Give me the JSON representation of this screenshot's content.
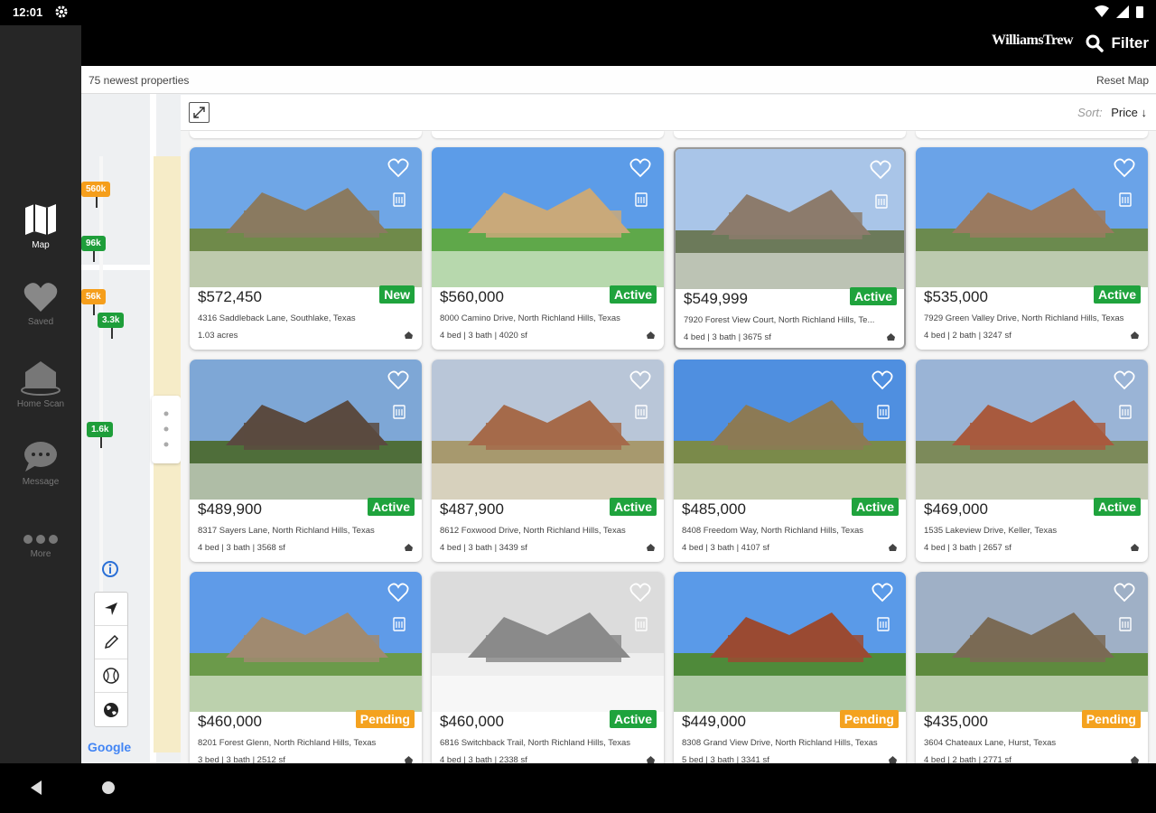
{
  "status_bar": {
    "time": "12:01"
  },
  "sidebar": {
    "items": [
      {
        "label": "Map",
        "icon": "map-icon",
        "active": true
      },
      {
        "label": "Saved",
        "icon": "heart-icon",
        "active": false
      },
      {
        "label": "Home Scan",
        "icon": "home-scan-icon",
        "active": false
      },
      {
        "label": "Message",
        "icon": "message-icon",
        "active": false
      },
      {
        "label": "More",
        "icon": "more-icon",
        "active": false
      }
    ]
  },
  "header": {
    "logo": "WilliamsTrew",
    "filter_label": "Filter"
  },
  "map": {
    "count_text": "75 newest properties",
    "reset_label": "Reset Map",
    "google": "Google",
    "pins": [
      {
        "label": "560k",
        "color": "orange"
      },
      {
        "label": "96k",
        "color": "green"
      },
      {
        "label": "56k",
        "color": "orange"
      },
      {
        "label": "3.3k",
        "color": "green"
      },
      {
        "label": "1.6k",
        "color": "green"
      }
    ]
  },
  "panel": {
    "sort_label": "Sort:",
    "sort_value": "Price ↓"
  },
  "listings": [
    {
      "price": "$572,450",
      "status": "New",
      "address": "4316 Saddleback Lane, Southlake, Texas",
      "details": "1.03 acres"
    },
    {
      "price": "$560,000",
      "status": "Active",
      "address": "8000 Camino Drive, North Richland Hills, Texas",
      "details": "4 bed | 3 bath | 4020 sf"
    },
    {
      "price": "$549,999",
      "status": "Active",
      "address": "7920 Forest View Court, North Richland Hills, Te...",
      "details": "4 bed | 3 bath | 3675 sf"
    },
    {
      "price": "$535,000",
      "status": "Active",
      "address": "7929 Green Valley Drive, North Richland Hills, Texas",
      "details": "4 bed | 2 bath | 3247 sf"
    },
    {
      "price": "$489,900",
      "status": "Active",
      "address": "8317 Sayers Lane, North Richland Hills, Texas",
      "details": "4 bed | 3 bath | 3568 sf"
    },
    {
      "price": "$487,900",
      "status": "Active",
      "address": "8612 Foxwood Drive, North Richland Hills, Texas",
      "details": "4 bed | 3 bath | 3439 sf"
    },
    {
      "price": "$485,000",
      "status": "Active",
      "address": "8408 Freedom Way, North Richland Hills, Texas",
      "details": "4 bed | 3 bath | 4107 sf"
    },
    {
      "price": "$469,000",
      "status": "Active",
      "address": "1535 Lakeview Drive, Keller, Texas",
      "details": "4 bed | 3 bath | 2657 sf"
    },
    {
      "price": "$460,000",
      "status": "Pending",
      "address": "8201 Forest Glenn, North Richland Hills, Texas",
      "details": "3 bed | 3 bath | 2512 sf"
    },
    {
      "price": "$460,000",
      "status": "Active",
      "address": "6816 Switchback Trail, North Richland Hills, Texas",
      "details": "4 bed | 3 bath | 2338 sf"
    },
    {
      "price": "$449,000",
      "status": "Pending",
      "address": "8308 Grand View Drive, North Richland Hills, Texas",
      "details": "5 bed | 3 bath | 3341 sf"
    },
    {
      "price": "$435,000",
      "status": "Pending",
      "address": "3604 Chateaux Lane, Hurst, Texas",
      "details": "4 bed | 2 bath | 2771 sf"
    }
  ],
  "colors": {
    "active": "#1fa33d",
    "pending": "#f4a21f",
    "sidebar_bg": "#262626"
  }
}
